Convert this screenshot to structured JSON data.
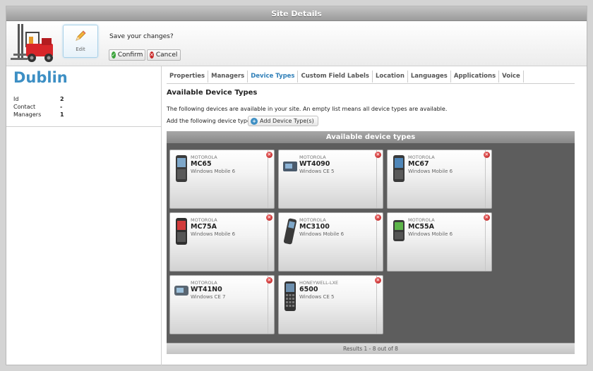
{
  "window": {
    "title": "Site Details"
  },
  "toolbar": {
    "edit_label": "Edit",
    "save_prompt": "Save your changes?",
    "confirm_label": "Confirm",
    "cancel_label": "Cancel"
  },
  "site": {
    "name": "Dublin",
    "properties": [
      {
        "key": "Id",
        "value": "2"
      },
      {
        "key": "Contact",
        "value": "-"
      },
      {
        "key": "Managers",
        "value": "1"
      }
    ]
  },
  "tabs": [
    {
      "label": "Properties",
      "active": false
    },
    {
      "label": "Managers",
      "active": false
    },
    {
      "label": "Device Types",
      "active": true
    },
    {
      "label": "Custom Field Labels",
      "active": false
    },
    {
      "label": "Location",
      "active": false
    },
    {
      "label": "Languages",
      "active": false
    },
    {
      "label": "Applications",
      "active": false
    },
    {
      "label": "Voice",
      "active": false
    }
  ],
  "content": {
    "title": "Available Device Types",
    "description": "The following devices are available in your site. An empty list means all device types are available.",
    "add_label": "Add the following device type:",
    "add_button": "Add Device Type(s)"
  },
  "panel": {
    "header": "Available device types",
    "footer": "Results 1 - 8 out of 8",
    "devices": [
      {
        "manufacturer": "MOTOROLA",
        "model": "MC65",
        "os": "Windows Mobile 6",
        "icon": "handheld-icon"
      },
      {
        "manufacturer": "MOTOROLA",
        "model": "WT4090",
        "os": "Windows CE 5",
        "icon": "wearable-icon"
      },
      {
        "manufacturer": "MOTOROLA",
        "model": "MC67",
        "os": "Windows Mobile 6",
        "icon": "handheld-icon"
      },
      {
        "manufacturer": "MOTOROLA",
        "model": "MC75A",
        "os": "Windows Mobile 6",
        "icon": "handheld-icon"
      },
      {
        "manufacturer": "MOTOROLA",
        "model": "MC3100",
        "os": "Windows Mobile 6",
        "icon": "scanner-icon"
      },
      {
        "manufacturer": "MOTOROLA",
        "model": "MC55A",
        "os": "Windows Mobile 6",
        "icon": "handheld-green-icon"
      },
      {
        "manufacturer": "MOTOROLA",
        "model": "WT41N0",
        "os": "Windows CE 7",
        "icon": "wearable-icon"
      },
      {
        "manufacturer": "HONEYWELL-LXE",
        "model": "6500",
        "os": "Windows CE 5",
        "icon": "keypad-device-icon"
      }
    ]
  },
  "colors": {
    "accent": "#3d8fc4",
    "panel_bg": "#5d5d5d",
    "confirm_green": "#3aa33a",
    "cancel_red": "#c82828"
  }
}
